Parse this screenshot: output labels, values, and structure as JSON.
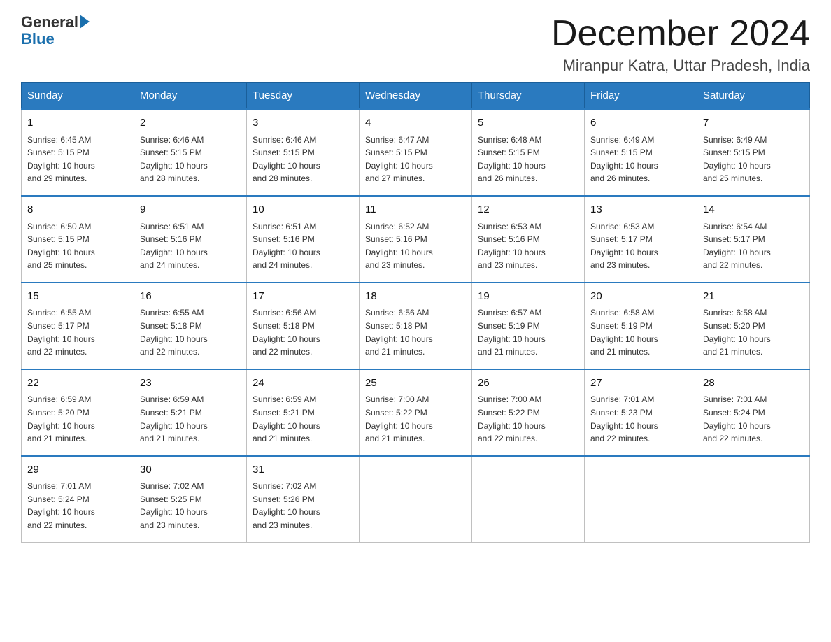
{
  "header": {
    "title": "December 2024",
    "subtitle": "Miranpur Katra, Uttar Pradesh, India",
    "logo": {
      "general": "General",
      "blue": "Blue"
    }
  },
  "weekdays": [
    "Sunday",
    "Monday",
    "Tuesday",
    "Wednesday",
    "Thursday",
    "Friday",
    "Saturday"
  ],
  "weeks": [
    [
      {
        "day": "1",
        "sunrise": "6:45 AM",
        "sunset": "5:15 PM",
        "daylight": "10 hours and 29 minutes."
      },
      {
        "day": "2",
        "sunrise": "6:46 AM",
        "sunset": "5:15 PM",
        "daylight": "10 hours and 28 minutes."
      },
      {
        "day": "3",
        "sunrise": "6:46 AM",
        "sunset": "5:15 PM",
        "daylight": "10 hours and 28 minutes."
      },
      {
        "day": "4",
        "sunrise": "6:47 AM",
        "sunset": "5:15 PM",
        "daylight": "10 hours and 27 minutes."
      },
      {
        "day": "5",
        "sunrise": "6:48 AM",
        "sunset": "5:15 PM",
        "daylight": "10 hours and 26 minutes."
      },
      {
        "day": "6",
        "sunrise": "6:49 AM",
        "sunset": "5:15 PM",
        "daylight": "10 hours and 26 minutes."
      },
      {
        "day": "7",
        "sunrise": "6:49 AM",
        "sunset": "5:15 PM",
        "daylight": "10 hours and 25 minutes."
      }
    ],
    [
      {
        "day": "8",
        "sunrise": "6:50 AM",
        "sunset": "5:15 PM",
        "daylight": "10 hours and 25 minutes."
      },
      {
        "day": "9",
        "sunrise": "6:51 AM",
        "sunset": "5:16 PM",
        "daylight": "10 hours and 24 minutes."
      },
      {
        "day": "10",
        "sunrise": "6:51 AM",
        "sunset": "5:16 PM",
        "daylight": "10 hours and 24 minutes."
      },
      {
        "day": "11",
        "sunrise": "6:52 AM",
        "sunset": "5:16 PM",
        "daylight": "10 hours and 23 minutes."
      },
      {
        "day": "12",
        "sunrise": "6:53 AM",
        "sunset": "5:16 PM",
        "daylight": "10 hours and 23 minutes."
      },
      {
        "day": "13",
        "sunrise": "6:53 AM",
        "sunset": "5:17 PM",
        "daylight": "10 hours and 23 minutes."
      },
      {
        "day": "14",
        "sunrise": "6:54 AM",
        "sunset": "5:17 PM",
        "daylight": "10 hours and 22 minutes."
      }
    ],
    [
      {
        "day": "15",
        "sunrise": "6:55 AM",
        "sunset": "5:17 PM",
        "daylight": "10 hours and 22 minutes."
      },
      {
        "day": "16",
        "sunrise": "6:55 AM",
        "sunset": "5:18 PM",
        "daylight": "10 hours and 22 minutes."
      },
      {
        "day": "17",
        "sunrise": "6:56 AM",
        "sunset": "5:18 PM",
        "daylight": "10 hours and 22 minutes."
      },
      {
        "day": "18",
        "sunrise": "6:56 AM",
        "sunset": "5:18 PM",
        "daylight": "10 hours and 21 minutes."
      },
      {
        "day": "19",
        "sunrise": "6:57 AM",
        "sunset": "5:19 PM",
        "daylight": "10 hours and 21 minutes."
      },
      {
        "day": "20",
        "sunrise": "6:58 AM",
        "sunset": "5:19 PM",
        "daylight": "10 hours and 21 minutes."
      },
      {
        "day": "21",
        "sunrise": "6:58 AM",
        "sunset": "5:20 PM",
        "daylight": "10 hours and 21 minutes."
      }
    ],
    [
      {
        "day": "22",
        "sunrise": "6:59 AM",
        "sunset": "5:20 PM",
        "daylight": "10 hours and 21 minutes."
      },
      {
        "day": "23",
        "sunrise": "6:59 AM",
        "sunset": "5:21 PM",
        "daylight": "10 hours and 21 minutes."
      },
      {
        "day": "24",
        "sunrise": "6:59 AM",
        "sunset": "5:21 PM",
        "daylight": "10 hours and 21 minutes."
      },
      {
        "day": "25",
        "sunrise": "7:00 AM",
        "sunset": "5:22 PM",
        "daylight": "10 hours and 21 minutes."
      },
      {
        "day": "26",
        "sunrise": "7:00 AM",
        "sunset": "5:22 PM",
        "daylight": "10 hours and 22 minutes."
      },
      {
        "day": "27",
        "sunrise": "7:01 AM",
        "sunset": "5:23 PM",
        "daylight": "10 hours and 22 minutes."
      },
      {
        "day": "28",
        "sunrise": "7:01 AM",
        "sunset": "5:24 PM",
        "daylight": "10 hours and 22 minutes."
      }
    ],
    [
      {
        "day": "29",
        "sunrise": "7:01 AM",
        "sunset": "5:24 PM",
        "daylight": "10 hours and 22 minutes."
      },
      {
        "day": "30",
        "sunrise": "7:02 AM",
        "sunset": "5:25 PM",
        "daylight": "10 hours and 23 minutes."
      },
      {
        "day": "31",
        "sunrise": "7:02 AM",
        "sunset": "5:26 PM",
        "daylight": "10 hours and 23 minutes."
      },
      null,
      null,
      null,
      null
    ]
  ],
  "labels": {
    "sunrise": "Sunrise:",
    "sunset": "Sunset:",
    "daylight": "Daylight:"
  }
}
